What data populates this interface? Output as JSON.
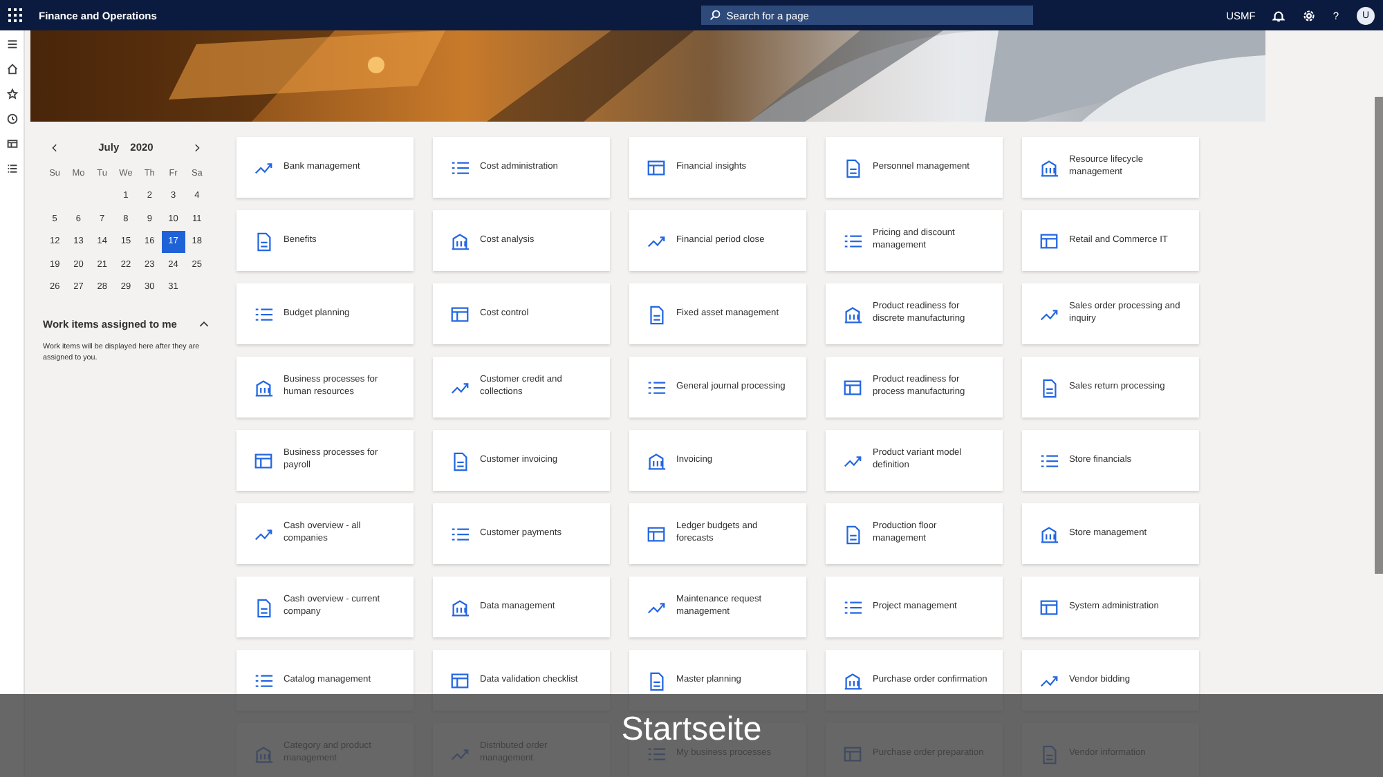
{
  "topbar": {
    "title": "Finance and Operations",
    "search_placeholder": "Search for a page",
    "company": "USMF",
    "help": "?",
    "avatar": "U"
  },
  "calendar": {
    "month": "July",
    "year": "2020",
    "weekdays": [
      "Su",
      "Mo",
      "Tu",
      "We",
      "Th",
      "Fr",
      "Sa"
    ],
    "weeks": [
      [
        {
          "day": "1",
          "selected": false
        },
        {
          "day": "2",
          "selected": false
        },
        {
          "day": "3",
          "selected": false
        },
        {
          "day": "4",
          "selected": false
        }
      ],
      [
        {
          "day": "5",
          "selected": false
        },
        {
          "day": "6",
          "selected": false
        },
        {
          "day": "7",
          "selected": false
        },
        {
          "day": "8",
          "selected": false
        },
        {
          "day": "9",
          "selected": false
        },
        {
          "day": "10",
          "selected": false
        },
        {
          "day": "11",
          "selected": false
        }
      ],
      [
        {
          "day": "12",
          "selected": false
        },
        {
          "day": "13",
          "selected": false
        },
        {
          "day": "14",
          "selected": false
        },
        {
          "day": "15",
          "selected": false
        },
        {
          "day": "16",
          "selected": false
        },
        {
          "day": "17",
          "selected": true
        },
        {
          "day": "18",
          "selected": false
        }
      ],
      [
        {
          "day": "19",
          "selected": false
        },
        {
          "day": "20",
          "selected": false
        },
        {
          "day": "21",
          "selected": false
        },
        {
          "day": "22",
          "selected": false
        },
        {
          "day": "23",
          "selected": false
        },
        {
          "day": "24",
          "selected": false
        },
        {
          "day": "25",
          "selected": false
        }
      ],
      [
        {
          "day": "26",
          "selected": false
        },
        {
          "day": "27",
          "selected": false
        },
        {
          "day": "28",
          "selected": false
        },
        {
          "day": "29",
          "selected": false
        },
        {
          "day": "30",
          "selected": false
        },
        {
          "day": "31",
          "selected": false
        }
      ]
    ]
  },
  "work_items": {
    "title": "Work items assigned to me",
    "expanded": true,
    "message": "Work items will be displayed here after they are assigned to you."
  },
  "tiles": [
    {
      "label": "Bank management"
    },
    {
      "label": "Cost administration"
    },
    {
      "label": "Financial insights"
    },
    {
      "label": "Personnel management"
    },
    {
      "label": "Resource lifecycle management"
    },
    {
      "label": "Benefits"
    },
    {
      "label": "Cost analysis"
    },
    {
      "label": "Financial period close"
    },
    {
      "label": "Pricing and discount management"
    },
    {
      "label": "Retail and Commerce IT"
    },
    {
      "label": "Budget planning"
    },
    {
      "label": "Cost control"
    },
    {
      "label": "Fixed asset management"
    },
    {
      "label": "Product readiness for discrete manufacturing"
    },
    {
      "label": "Sales order processing and inquiry"
    },
    {
      "label": "Business processes for human resources"
    },
    {
      "label": "Customer credit and collections"
    },
    {
      "label": "General journal processing"
    },
    {
      "label": "Product readiness for process manufacturing"
    },
    {
      "label": "Sales return processing"
    },
    {
      "label": "Business processes for payroll"
    },
    {
      "label": "Customer invoicing"
    },
    {
      "label": "Invoicing"
    },
    {
      "label": "Product variant model definition"
    },
    {
      "label": "Store financials"
    },
    {
      "label": "Cash overview - all companies"
    },
    {
      "label": "Customer payments"
    },
    {
      "label": "Ledger budgets and forecasts"
    },
    {
      "label": "Production floor management"
    },
    {
      "label": "Store management"
    },
    {
      "label": "Cash overview - current company"
    },
    {
      "label": "Data management"
    },
    {
      "label": "Maintenance request management"
    },
    {
      "label": "Project management"
    },
    {
      "label": "System administration"
    },
    {
      "label": "Catalog management"
    },
    {
      "label": "Data validation checklist"
    },
    {
      "label": "Master planning"
    },
    {
      "label": "Purchase order confirmation"
    },
    {
      "label": "Vendor bidding"
    },
    {
      "label": "Category and product management"
    },
    {
      "label": "Distributed order management"
    },
    {
      "label": "My business processes"
    },
    {
      "label": "Purchase order preparation"
    },
    {
      "label": "Vendor information"
    }
  ],
  "caption": "Startseite"
}
